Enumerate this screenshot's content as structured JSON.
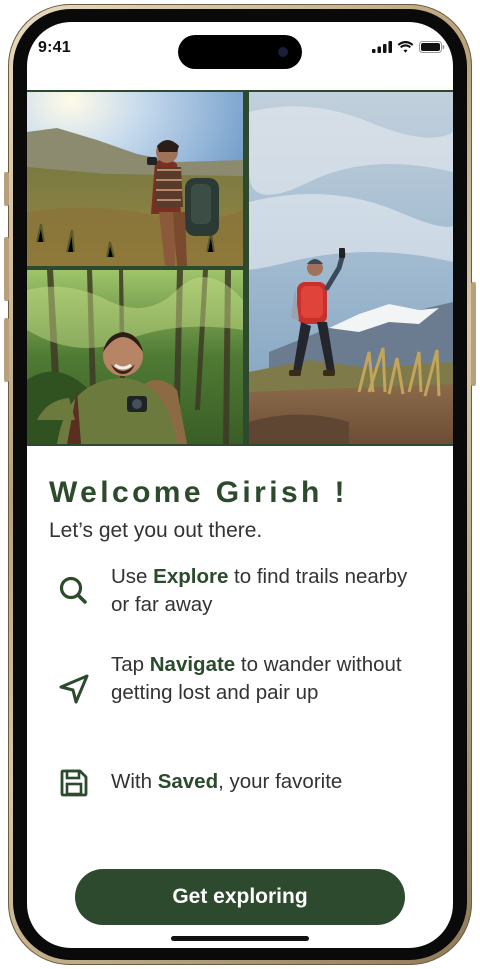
{
  "status_bar": {
    "time": "9:41",
    "icons": [
      "cellular-signal-icon",
      "wifi-icon",
      "battery-icon"
    ]
  },
  "collage": {
    "photos": [
      {
        "name": "hiker-valley-photo"
      },
      {
        "name": "hiker-mountain-summit-photo"
      },
      {
        "name": "hiker-forest-selfie-photo"
      }
    ]
  },
  "welcome": {
    "title": "Welcome Girish !",
    "subtitle": "Let’s get you out there."
  },
  "features": [
    {
      "icon": "search-icon",
      "before": "Use ",
      "keyword": "Explore",
      "after": " to find trails nearby or far away"
    },
    {
      "icon": "navigate-arrow-icon",
      "before": "Tap ",
      "keyword": "Navigate",
      "after": " to wander without getting lost and pair up"
    },
    {
      "icon": "save-disk-icon",
      "before": "With ",
      "keyword": "Saved",
      "after": ", your favorite"
    }
  ],
  "cta": {
    "label": "Get exploring"
  },
  "colors": {
    "brand_green": "#2d4a2e",
    "text": "#333333"
  }
}
